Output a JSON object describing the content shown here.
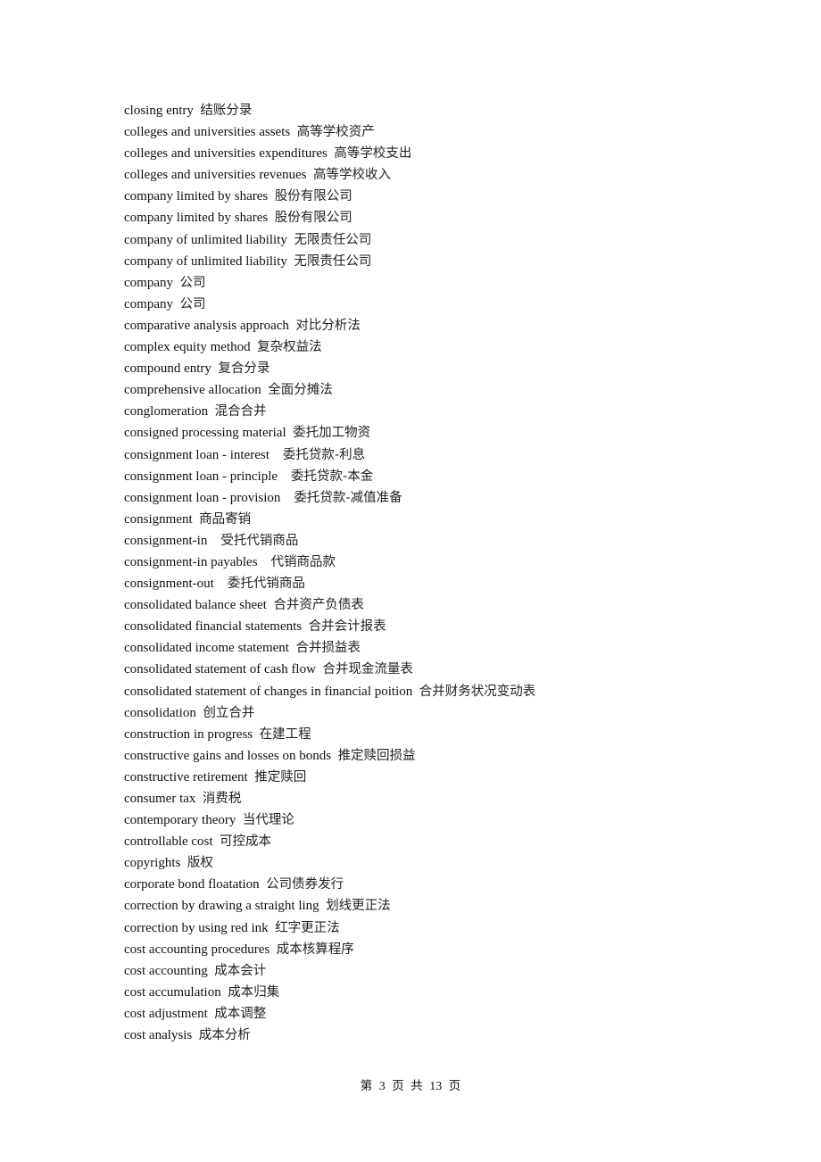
{
  "document": {
    "entries": [
      {
        "term": "closing entry",
        "sep": "  ",
        "translation": "结账分录"
      },
      {
        "term": "colleges and universities assets",
        "sep": "  ",
        "translation": "高等学校资产"
      },
      {
        "term": "colleges and universities expenditures",
        "sep": "  ",
        "translation": "高等学校支出"
      },
      {
        "term": "colleges and universities revenues",
        "sep": "  ",
        "translation": "高等学校收入"
      },
      {
        "term": "company limited by shares",
        "sep": "  ",
        "translation": "股份有限公司"
      },
      {
        "term": "company limited by shares",
        "sep": "  ",
        "translation": "股份有限公司"
      },
      {
        "term": "company of unlimited liability",
        "sep": "  ",
        "translation": "无限责任公司"
      },
      {
        "term": "company of unlimited liability",
        "sep": "  ",
        "translation": "无限责任公司"
      },
      {
        "term": "company",
        "sep": "  ",
        "translation": "公司"
      },
      {
        "term": "company",
        "sep": "  ",
        "translation": "公司"
      },
      {
        "term": "comparative analysis approach",
        "sep": "  ",
        "translation": "对比分析法"
      },
      {
        "term": "complex equity method",
        "sep": "  ",
        "translation": "复杂权益法"
      },
      {
        "term": "compound entry",
        "sep": "  ",
        "translation": "复合分录"
      },
      {
        "term": "comprehensive allocation",
        "sep": "  ",
        "translation": "全面分摊法"
      },
      {
        "term": "conglomeration",
        "sep": "  ",
        "translation": "混合合并"
      },
      {
        "term": "consigned processing material",
        "sep": "  ",
        "translation": "委托加工物资"
      },
      {
        "term": "consignment loan - interest",
        "sep": "    ",
        "translation": "委托贷款-利息"
      },
      {
        "term": "consignment loan - principle",
        "sep": "    ",
        "translation": "委托贷款-本金"
      },
      {
        "term": "consignment loan - provision",
        "sep": "    ",
        "translation": "委托贷款-减值准备"
      },
      {
        "term": "consignment",
        "sep": "  ",
        "translation": "商品寄销"
      },
      {
        "term": "consignment-in",
        "sep": "    ",
        "translation": "受托代销商品"
      },
      {
        "term": "consignment-in payables",
        "sep": "    ",
        "translation": "代销商品款"
      },
      {
        "term": "consignment-out",
        "sep": "    ",
        "translation": "委托代销商品"
      },
      {
        "term": "consolidated balance sheet",
        "sep": "  ",
        "translation": "合并资产负债表"
      },
      {
        "term": "consolidated financial statements",
        "sep": "  ",
        "translation": "合并会计报表"
      },
      {
        "term": "consolidated income statement",
        "sep": "  ",
        "translation": "合并损益表"
      },
      {
        "term": "consolidated statement of cash flow",
        "sep": "  ",
        "translation": "合并现金流量表"
      },
      {
        "term": "consolidated statement of changes in financial poition",
        "sep": "  ",
        "translation": "合并财务状况变动表"
      },
      {
        "term": "consolidation",
        "sep": "  ",
        "translation": "创立合并"
      },
      {
        "term": "construction in progress",
        "sep": "  ",
        "translation": "在建工程"
      },
      {
        "term": "constructive gains and losses on bonds",
        "sep": "  ",
        "translation": "推定赎回损益"
      },
      {
        "term": "constructive retirement",
        "sep": "  ",
        "translation": "推定赎回"
      },
      {
        "term": "consumer tax",
        "sep": "  ",
        "translation": "消费税"
      },
      {
        "term": "contemporary theory",
        "sep": "  ",
        "translation": "当代理论"
      },
      {
        "term": "controllable cost",
        "sep": "  ",
        "translation": "可控成本"
      },
      {
        "term": "copyrights",
        "sep": "  ",
        "translation": "版权"
      },
      {
        "term": "corporate bond floatation",
        "sep": "  ",
        "translation": "公司债券发行"
      },
      {
        "term": "correction by drawing a straight ling",
        "sep": "  ",
        "translation": "划线更正法"
      },
      {
        "term": "correction by using red ink",
        "sep": "  ",
        "translation": "红字更正法"
      },
      {
        "term": "cost accounting procedures",
        "sep": "  ",
        "translation": "成本核算程序"
      },
      {
        "term": "cost accounting",
        "sep": "  ",
        "translation": "成本会计"
      },
      {
        "term": "cost accumulation",
        "sep": "  ",
        "translation": "成本归集"
      },
      {
        "term": "cost adjustment",
        "sep": "  ",
        "translation": "成本调整"
      },
      {
        "term": "cost analysis",
        "sep": "  ",
        "translation": "成本分析"
      }
    ],
    "footer": {
      "prefix": "第",
      "current_page": "3",
      "page_word": "页",
      "total_prefix": "共",
      "total_pages": "13",
      "suffix": "页"
    }
  }
}
